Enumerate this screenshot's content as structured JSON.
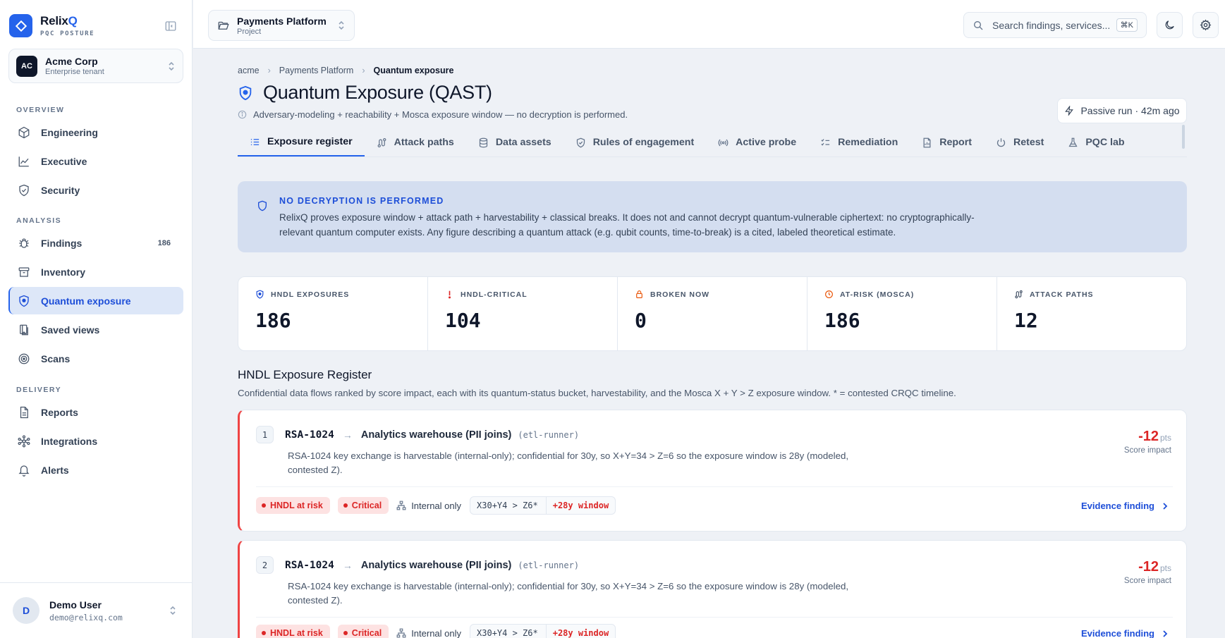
{
  "brand": {
    "name_main": "Relix",
    "name_accent": "Q",
    "subtitle": "PQC POSTURE"
  },
  "tenant": {
    "initials": "AC",
    "name": "Acme Corp",
    "subtitle": "Enterprise tenant"
  },
  "nav": {
    "overview_label": "OVERVIEW",
    "analysis_label": "ANALYSIS",
    "delivery_label": "DELIVERY",
    "items": [
      {
        "label": "Engineering",
        "icon": "cube-icon"
      },
      {
        "label": "Executive",
        "icon": "chart-line-icon"
      },
      {
        "label": "Security",
        "icon": "shield-check-icon"
      },
      {
        "label": "Findings",
        "icon": "bug-icon",
        "count": "186"
      },
      {
        "label": "Inventory",
        "icon": "archive-icon"
      },
      {
        "label": "Quantum exposure",
        "icon": "shield-icon",
        "active": true
      },
      {
        "label": "Saved views",
        "icon": "bookmark-icon"
      },
      {
        "label": "Scans",
        "icon": "radar-icon"
      },
      {
        "label": "Reports",
        "icon": "file-icon"
      },
      {
        "label": "Integrations",
        "icon": "network-icon"
      },
      {
        "label": "Alerts",
        "icon": "bell-icon"
      }
    ]
  },
  "user": {
    "initial": "D",
    "name": "Demo User",
    "email": "demo@relixq.com"
  },
  "topbar": {
    "project_name": "Payments Platform",
    "project_sub": "Project",
    "search_placeholder": "Search findings, services...",
    "search_shortcut": "⌘K"
  },
  "breadcrumb": [
    "acme",
    "Payments Platform",
    "Quantum exposure"
  ],
  "page": {
    "title": "Quantum Exposure (QAST)",
    "subtitle": "Adversary-modeling + reachability + Mosca exposure window — no decryption is performed.",
    "run_status": "Passive run · 42m ago"
  },
  "tabs": [
    {
      "label": "Exposure register",
      "icon": "list-icon",
      "active": true
    },
    {
      "label": "Attack paths",
      "icon": "route-icon"
    },
    {
      "label": "Data assets",
      "icon": "database-icon"
    },
    {
      "label": "Rules of engagement",
      "icon": "shield-check-icon"
    },
    {
      "label": "Active probe",
      "icon": "signal-icon"
    },
    {
      "label": "Remediation",
      "icon": "checklist-icon"
    },
    {
      "label": "Report",
      "icon": "report-icon"
    },
    {
      "label": "Retest",
      "icon": "power-icon"
    },
    {
      "label": "PQC lab",
      "icon": "flask-icon"
    }
  ],
  "banner": {
    "title": "NO DECRYPTION IS PERFORMED",
    "body": "RelixQ proves exposure window + attack path + harvestability + classical breaks. It does not and cannot decrypt quantum-vulnerable ciphertext: no cryptographically-relevant quantum computer exists. Any figure describing a quantum attack (e.g. qubit counts, time-to-break) is a cited, labeled theoretical estimate."
  },
  "kpis": [
    {
      "label": "HNDL EXPOSURES",
      "value": "186",
      "icon": "shield-icon",
      "color": "#1d4ed8"
    },
    {
      "label": "HNDL-CRITICAL",
      "value": "104",
      "icon": "exclamation-icon",
      "color": "#dc2626"
    },
    {
      "label": "BROKEN NOW",
      "value": "0",
      "icon": "lock-icon",
      "color": "#ea580c"
    },
    {
      "label": "AT-RISK (MOSCA)",
      "value": "186",
      "icon": "clock-icon",
      "color": "#ea580c"
    },
    {
      "label": "ATTACK PATHS",
      "value": "12",
      "icon": "route-icon",
      "color": "#475569"
    }
  ],
  "register": {
    "title": "HNDL Exposure Register",
    "subtitle": "Confidential data flows ranked by score impact, each with its quantum-status bucket, harvestability, and the Mosca X + Y > Z exposure window. * = contested CRQC timeline.",
    "items": [
      {
        "rank": "1",
        "algorithm": "RSA-1024",
        "destination": "Analytics warehouse (PII joins)",
        "runner": "(etl-runner)",
        "description": "RSA-1024 key exchange is harvestable (internal-only); confidential for 30y, so X+Y=34 > Z=6 so the exposure window is 28y (modeled, contested Z).",
        "score": "-12",
        "score_unit": "pts",
        "score_label": "Score impact",
        "status_badge": "HNDL at risk",
        "severity_badge": "Critical",
        "reachability": "Internal only",
        "mosca_formula": "X30+Y4 > Z6*",
        "window": "+28y window",
        "evidence_label": "Evidence finding"
      },
      {
        "rank": "2",
        "algorithm": "RSA-1024",
        "destination": "Analytics warehouse (PII joins)",
        "runner": "(etl-runner)",
        "description": "RSA-1024 key exchange is harvestable (internal-only); confidential for 30y, so X+Y=34 > Z=6 so the exposure window is 28y (modeled, contested Z).",
        "score": "-12",
        "score_unit": "pts",
        "score_label": "Score impact",
        "status_badge": "HNDL at risk",
        "severity_badge": "Critical",
        "reachability": "Internal only",
        "mosca_formula": "X30+Y4 > Z6*",
        "window": "+28y window",
        "evidence_label": "Evidence finding"
      }
    ]
  },
  "colors": {
    "accent": "#2563eb",
    "danger": "#dc2626",
    "banner_bg": "#d4def0",
    "active_nav_bg": "#dde7f8"
  }
}
